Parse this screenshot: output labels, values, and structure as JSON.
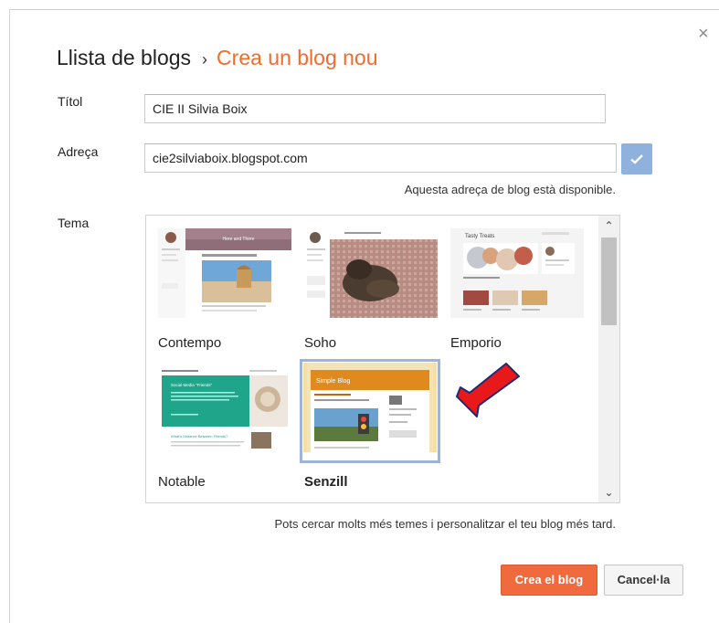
{
  "dialog": {
    "breadcrumb_parent": "Llista de blogs",
    "breadcrumb_separator": "›",
    "breadcrumb_current": "Crea un blog nou",
    "close_glyph": "×"
  },
  "form": {
    "title_label": "Títol",
    "title_value": "CIE II Silvia Boix",
    "address_label": "Adreça",
    "address_value": "cie2silviaboix.blogspot.com",
    "address_status": "Aquesta adreça de blog està disponible.",
    "theme_label": "Tema"
  },
  "themes": {
    "items": [
      {
        "name": "Contempo",
        "selected": false,
        "preview_title": "Here and There"
      },
      {
        "name": "Soho",
        "selected": false
      },
      {
        "name": "Emporio",
        "selected": false,
        "preview_title": "Tasty Treats"
      },
      {
        "name": "Notable",
        "selected": false,
        "preview_title": "Social Media \"Friends\"",
        "preview_subtitle": "What's Distance Between Friends?"
      },
      {
        "name": "Senzill",
        "selected": true,
        "preview_title": "Simple Blog"
      }
    ],
    "hint": "Pots cercar molts més temes i personalitzar el teu blog més tard."
  },
  "actions": {
    "create_label": "Crea el blog",
    "cancel_label": "Cancel·la"
  },
  "colors": {
    "accent": "#f26b2a",
    "primary_button": "#f06a3e",
    "check_button": "#8eb1de",
    "selection_border": "#9db3d8",
    "annotation_arrow": "#e8191b"
  }
}
